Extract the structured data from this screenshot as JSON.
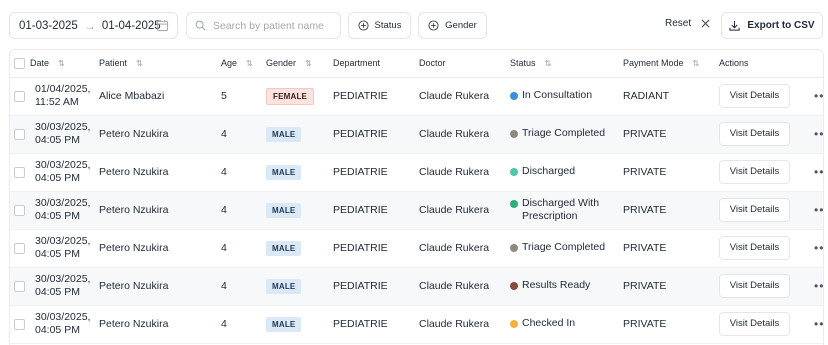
{
  "toolbar": {
    "date_from": "01-03-2025",
    "date_to": "01-04-2025",
    "search_placeholder": "Search by patient name",
    "status_filter": "Status",
    "gender_filter": "Gender",
    "reset": "Reset",
    "export": "Export to CSV"
  },
  "columns": [
    "Date",
    "Patient",
    "Age",
    "Gender",
    "Department",
    "Doctor",
    "Status",
    "Payment Mode",
    "Actions"
  ],
  "rows": [
    {
      "date1": "01/04/2025,",
      "date2": "11:52 AM",
      "patient": "Alice Mbabazi",
      "age": "5",
      "gender": "FEMALE",
      "department": "PEDIATRIE",
      "doctor": "Claude Rukera",
      "status1": "In Consultation",
      "status2": "",
      "status_color": "#3b8fd9",
      "payment": "RADIANT",
      "action": "Visit Details"
    },
    {
      "date1": "30/03/2025,",
      "date2": "04:05 PM",
      "patient": "Petero Nzukira",
      "age": "4",
      "gender": "MALE",
      "department": "PEDIATRIE",
      "doctor": "Claude Rukera",
      "status1": "Triage Completed",
      "status2": "",
      "status_color": "#8f8a7d",
      "payment": "PRIVATE",
      "action": "Visit Details"
    },
    {
      "date1": "30/03/2025,",
      "date2": "04:05 PM",
      "patient": "Petero Nzukira",
      "age": "4",
      "gender": "MALE",
      "department": "PEDIATRIE",
      "doctor": "Claude Rukera",
      "status1": "Discharged",
      "status2": "",
      "status_color": "#4fc7a8",
      "payment": "PRIVATE",
      "action": "Visit Details"
    },
    {
      "date1": "30/03/2025,",
      "date2": "04:05 PM",
      "patient": "Petero Nzukira",
      "age": "4",
      "gender": "MALE",
      "department": "PEDIATRIE",
      "doctor": "Claude Rukera",
      "status1": "Discharged With",
      "status2": "Prescription",
      "status_color": "#2fae7a",
      "payment": "PRIVATE",
      "action": "Visit Details"
    },
    {
      "date1": "30/03/2025,",
      "date2": "04:05 PM",
      "patient": "Petero Nzukira",
      "age": "4",
      "gender": "MALE",
      "department": "PEDIATRIE",
      "doctor": "Claude Rukera",
      "status1": "Triage Completed",
      "status2": "",
      "status_color": "#8f8a7d",
      "payment": "PRIVATE",
      "action": "Visit Details"
    },
    {
      "date1": "30/03/2025,",
      "date2": "04:05 PM",
      "patient": "Petero Nzukira",
      "age": "4",
      "gender": "MALE",
      "department": "PEDIATRIE",
      "doctor": "Claude Rukera",
      "status1": "Results Ready",
      "status2": "",
      "status_color": "#8b4a3f",
      "payment": "PRIVATE",
      "action": "Visit Details"
    },
    {
      "date1": "30/03/2025,",
      "date2": "04:05 PM",
      "patient": "Petero Nzukira",
      "age": "4",
      "gender": "MALE",
      "department": "PEDIATRIE",
      "doctor": "Claude Rukera",
      "status1": "Checked In",
      "status2": "",
      "status_color": "#f2b23a",
      "payment": "PRIVATE",
      "action": "Visit Details"
    }
  ],
  "icons": {
    "date_arrow": "arrow-right-icon",
    "calendar": "calendar-icon",
    "search": "search-icon",
    "filter": "plus-circle-icon",
    "reset": "close-icon",
    "export": "download-icon",
    "sort": "sort-icon",
    "more": "more-horizontal-icon"
  }
}
